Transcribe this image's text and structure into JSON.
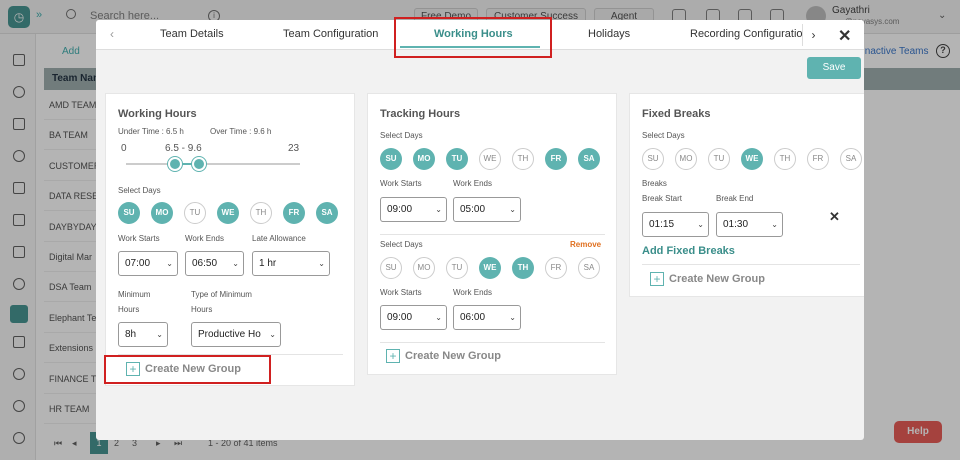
{
  "app": {
    "search_placeholder": "Search here...",
    "buttons": [
      "Free Demo",
      "Customer Success",
      "Agent"
    ],
    "user_name": "Gayathri",
    "user_email": "...@novasys.com",
    "add_label": "Add",
    "inactive_teams": "Inactive Teams",
    "table_header": "Team Name",
    "teams": [
      "AMD TEAM",
      "BA TEAM",
      "CUSTOMER",
      "DATA RESEA",
      "DAYBYDAY",
      "Digital Mar",
      "DSA Team",
      "Elephant Te",
      "Extensions",
      "FINANCE TE",
      "HR TEAM"
    ],
    "pages": [
      "1",
      "2",
      "3"
    ],
    "pager_info": "1 - 20 of 41 items",
    "help": "Help"
  },
  "modal": {
    "tabs": [
      "Team Details",
      "Team Configuration",
      "Working Hours",
      "Holidays",
      "Recording Configuration"
    ],
    "active_tab": "Working Hours",
    "save": "Save",
    "close": "✕",
    "accent": "#5fb3b0",
    "highlight": "#d02020"
  },
  "working_hours": {
    "title": "Working Hours",
    "under_time": "Under Time : 6.5 h",
    "over_time": "Over Time : 9.6 h",
    "range_min": "0",
    "range_values": "6.5 - 9.6",
    "range_max": "23",
    "slider": {
      "min": 0,
      "max": 23,
      "low": 6.5,
      "high": 9.6
    },
    "select_days_label": "Select Days",
    "days": [
      {
        "label": "SU",
        "on": true
      },
      {
        "label": "MO",
        "on": true
      },
      {
        "label": "TU",
        "on": false
      },
      {
        "label": "WE",
        "on": true
      },
      {
        "label": "TH",
        "on": false
      },
      {
        "label": "FR",
        "on": true
      },
      {
        "label": "SA",
        "on": true
      }
    ],
    "work_starts_label": "Work Starts",
    "work_ends_label": "Work Ends",
    "late_allowance_label": "Late Allowance",
    "work_starts": "07:00",
    "work_ends": "06:50",
    "late_allowance": "1 hr",
    "minimum_hours_label": "Minimum Hours",
    "minimum_hours_line1": "Minimum",
    "minimum_hours_line2": "Hours",
    "type_label_line1": "Type of Minimum",
    "type_label_line2": "Hours",
    "minimum_hours": "8h",
    "type_of_minimum": "Productive Ho",
    "create_group": "Create New Group"
  },
  "tracking_hours": {
    "title": "Tracking Hours",
    "groups": [
      {
        "select_days_label": "Select Days",
        "days": [
          {
            "label": "SU",
            "on": true
          },
          {
            "label": "MO",
            "on": true
          },
          {
            "label": "TU",
            "on": true
          },
          {
            "label": "WE",
            "on": false
          },
          {
            "label": "TH",
            "on": false
          },
          {
            "label": "FR",
            "on": true
          },
          {
            "label": "SA",
            "on": true
          }
        ],
        "work_starts_label": "Work Starts",
        "work_ends_label": "Work Ends",
        "work_starts": "09:00",
        "work_ends": "05:00"
      },
      {
        "select_days_label": "Select Days",
        "remove": "Remove",
        "days": [
          {
            "label": "SU",
            "on": false
          },
          {
            "label": "MO",
            "on": false
          },
          {
            "label": "TU",
            "on": false
          },
          {
            "label": "WE",
            "on": true
          },
          {
            "label": "TH",
            "on": true
          },
          {
            "label": "FR",
            "on": false
          },
          {
            "label": "SA",
            "on": false
          }
        ],
        "work_starts_label": "Work Starts",
        "work_ends_label": "Work Ends",
        "work_starts": "09:00",
        "work_ends": "06:00"
      }
    ],
    "create_group": "Create New Group"
  },
  "fixed_breaks": {
    "title": "Fixed Breaks",
    "select_days_label": "Select Days",
    "days": [
      {
        "label": "SU",
        "on": false
      },
      {
        "label": "MO",
        "on": false
      },
      {
        "label": "TU",
        "on": false
      },
      {
        "label": "WE",
        "on": true
      },
      {
        "label": "TH",
        "on": false
      },
      {
        "label": "FR",
        "on": false
      },
      {
        "label": "SA",
        "on": false
      }
    ],
    "breaks_label": "Breaks",
    "break_start_label": "Break Start",
    "break_end_label": "Break End",
    "break_start": "01:15",
    "break_end": "01:30",
    "add_fixed_breaks": "Add Fixed Breaks",
    "create_group": "Create New Group"
  }
}
